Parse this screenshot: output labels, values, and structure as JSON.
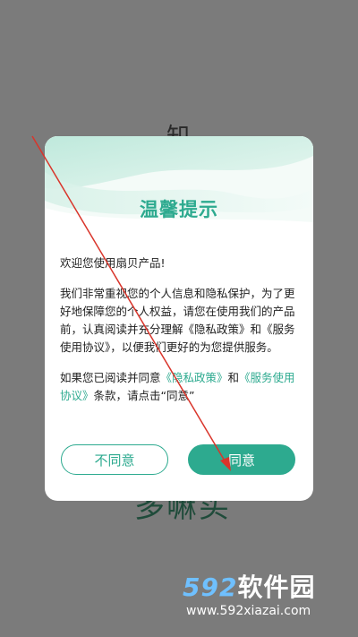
{
  "background": {
    "glyph_top": "知",
    "glyph_bottom": "多嘛买"
  },
  "dialog": {
    "title": "温馨提示",
    "greeting": "欢迎您使用扇贝产品!",
    "body": "我们非常重视您的个人信息和隐私保护，为了更好地保障您的个人权益，请您在使用我们的产品前，认真阅读并充分理解《隐私政策》和《服务使用协议》，以便我们更好的为您提供服务。",
    "consent": {
      "prefix": "如果您已阅读并同意",
      "privacy_link": "《隐私政策》",
      "and": "和",
      "service_link": "《服务使用协议》",
      "suffix": "条款，请点击“同意”"
    },
    "disagree_label": "不同意",
    "agree_label": "同意"
  },
  "watermark": {
    "logo_number": "592",
    "logo_text": "软件园",
    "url": "www.592xiazai.com"
  },
  "colors": {
    "accent": "#2daa8f",
    "overlay": "#7b7b7b",
    "annotation_arrow": "#d9352b"
  }
}
